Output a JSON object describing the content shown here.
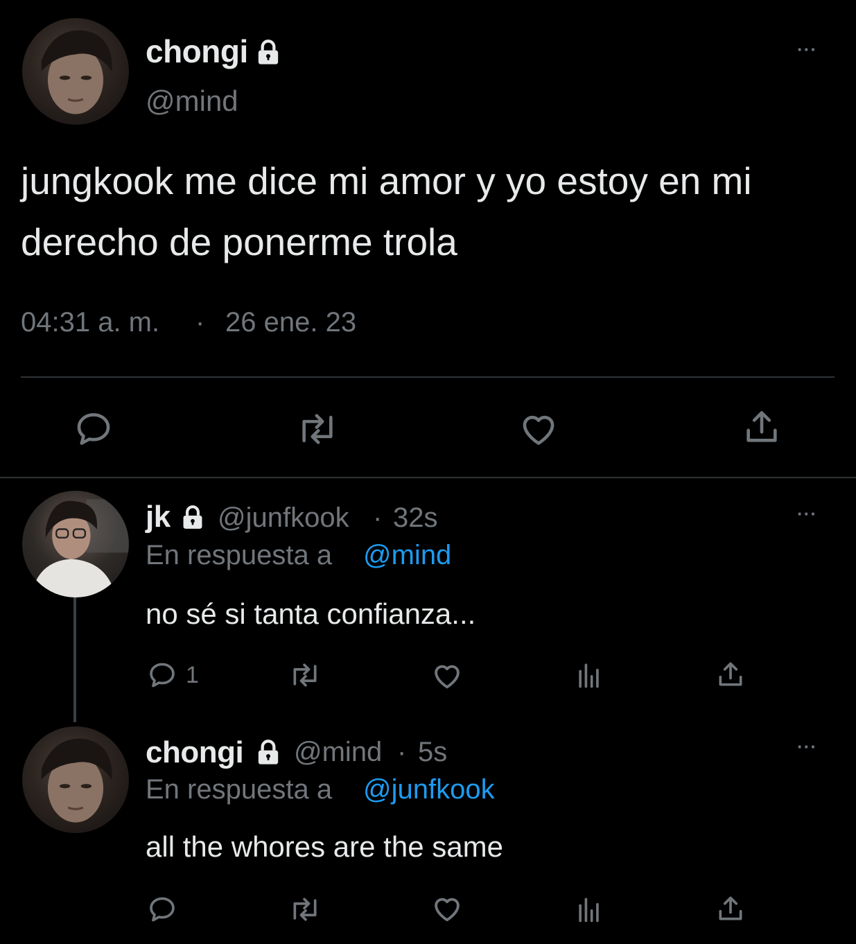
{
  "main_tweet": {
    "display_name": "chongi",
    "handle": "@mind",
    "text_line1": "jungkook me dice mi amor y yo estoy en mi",
    "text_line2": "derecho de ponerme trola",
    "time": "04:31 a. m.",
    "separator": "·",
    "date": "26 ene. 23"
  },
  "reply1": {
    "display_name": "jk",
    "handle": "@junfkook",
    "sep": "·",
    "age": "32s",
    "replying_prefix": "En respuesta a",
    "replying_to": "@mind",
    "text": "no sé si tanta confianza...",
    "reply_count": "1"
  },
  "reply2": {
    "display_name": "chongi",
    "handle": "@mind",
    "sep": "·",
    "age": "5s",
    "replying_prefix": "En respuesta a",
    "replying_to": "@junfkook",
    "text": "all the whores are the same"
  },
  "more_glyph": "···",
  "colors": {
    "background": "#000000",
    "text": "#e7e9ea",
    "muted": "#71767b",
    "link": "#1d9bf0",
    "divider": "#2f3336"
  },
  "icons": [
    "lock-icon",
    "more-icon",
    "reply-icon",
    "retweet-icon",
    "like-icon",
    "share-icon",
    "analytics-icon"
  ]
}
